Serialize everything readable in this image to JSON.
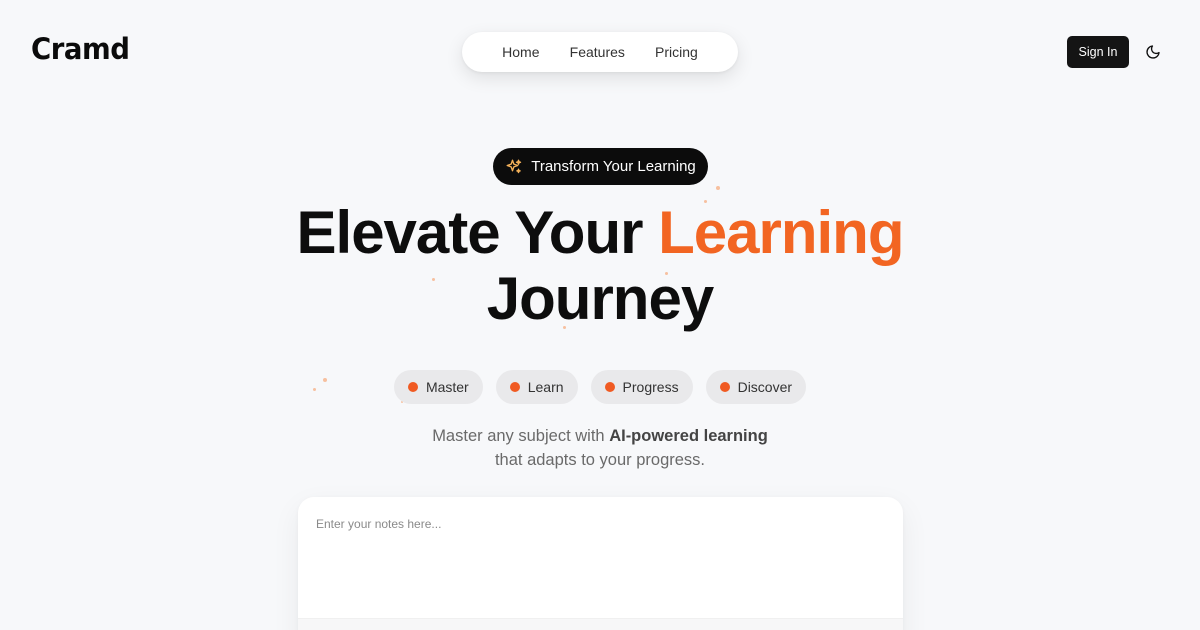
{
  "brand": {
    "name": "Cramd"
  },
  "nav": {
    "items": [
      {
        "label": "Home"
      },
      {
        "label": "Features"
      },
      {
        "label": "Pricing"
      }
    ]
  },
  "header": {
    "signin_label": "Sign In",
    "theme_icon": "moon-icon"
  },
  "hero": {
    "badge_icon": "sparkles-icon",
    "badge_label": "Transform Your Learning",
    "headline_part1": "Elevate Your ",
    "headline_accent": "Learning",
    "headline_part2": "Journey",
    "pills": [
      {
        "label": "Master"
      },
      {
        "label": "Learn"
      },
      {
        "label": "Progress"
      },
      {
        "label": "Discover"
      }
    ],
    "subtitle_part1": "Master any subject with ",
    "subtitle_bold": "AI-powered learning",
    "subtitle_part2": "that adapts to your progress."
  },
  "notes": {
    "placeholder": "Enter your notes here...",
    "value": ""
  },
  "colors": {
    "accent": "#f26522",
    "dark": "#0c0c0c",
    "background": "#f7f8fa"
  }
}
